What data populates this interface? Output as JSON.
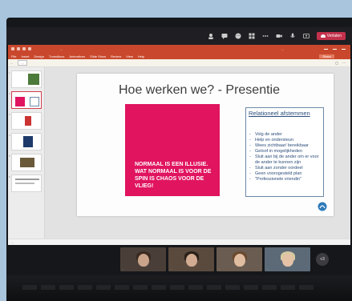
{
  "teams": {
    "leave_label": "Verlaten",
    "icons": [
      "people-icon",
      "chat-icon",
      "reactions-icon",
      "rooms-icon",
      "more-icon",
      "camera-icon",
      "mic-icon",
      "share-icon"
    ]
  },
  "powerpoint": {
    "title_bar": {
      "document_title": "...",
      "user": "...",
      "share_label": "Share"
    },
    "menu": [
      "File",
      "Insert",
      "Design",
      "Transitions",
      "Animations",
      "Slide Show",
      "Review",
      "View",
      "Help"
    ],
    "ribbon": {
      "notice": "...",
      "button": "..."
    },
    "slide_numbers": [
      "1",
      "2",
      "3",
      "4",
      "5",
      "6"
    ],
    "slide": {
      "title": "Hoe werken we? - Presentie",
      "pink_box_text": "NORMAAL IS EEN ILLUSIE. WAT NORMAAL IS VOOR DE SPIN IS CHAOS VOOR DE VLIEG!",
      "relational_heading": "Relationeel afstemmen",
      "relational_items": [
        "Volg de ander",
        "Help en ondersteun",
        "Wees zichtbaar/ bereikbaar",
        "Geloof in mogelijkheden",
        "Sluit aan bij de ander om er voor de ander te kunnen zijn",
        "Sluit aan zonder oordeel",
        "Geen voorogesteld plan",
        "\"Professionele vriendin\""
      ]
    },
    "status_bar": "..."
  },
  "participants": [
    {
      "name": "..."
    },
    {
      "name": "..."
    },
    {
      "name": "..."
    },
    {
      "name": "..."
    }
  ],
  "more_participants": "+3",
  "colors": {
    "ppt_accent": "#c9482d",
    "pink_box": "#e0145f",
    "heading_blue": "#2b4d7a",
    "leave_red": "#c4314b"
  }
}
